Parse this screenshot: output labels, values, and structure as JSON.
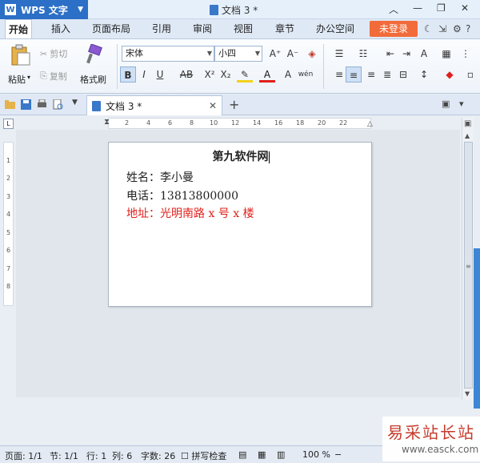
{
  "app": {
    "name": "WPS 文字",
    "doc_title": "文档 3 *"
  },
  "menu": [
    "开始",
    "插入",
    "页面布局",
    "引用",
    "审阅",
    "视图",
    "章节",
    "办公空间"
  ],
  "login_label": "未登录",
  "ribbon": {
    "paste": "粘贴",
    "cut": "剪切",
    "copy": "复制",
    "format_painter": "格式刷",
    "font_name": "宋体",
    "font_size": "小四"
  },
  "tab": {
    "label": "文档 3 *"
  },
  "ruler": {
    "h": [
      "2",
      "4",
      "6",
      "8",
      "10",
      "12",
      "14",
      "16",
      "18",
      "20",
      "22"
    ],
    "v": [
      "1",
      "2",
      "3",
      "4",
      "5",
      "6",
      "7",
      "8"
    ]
  },
  "document": {
    "title": "第九软件网",
    "lines": [
      {
        "text": "姓名：李小曼",
        "color": "#222222"
      },
      {
        "text": "电话：13813800000",
        "color": "#222222"
      },
      {
        "text": "地址：光明南路 x 号 x 楼",
        "color": "#e0201c"
      }
    ]
  },
  "status": {
    "page": "页面: 1/1",
    "section": "节: 1/1",
    "row": "行: 1",
    "col": "列: 6",
    "words": "字数: 26",
    "spell": "拼写检查",
    "zoom": "100 %"
  },
  "watermark": {
    "line1": "易采站长站",
    "line2": "www.easck.com"
  }
}
